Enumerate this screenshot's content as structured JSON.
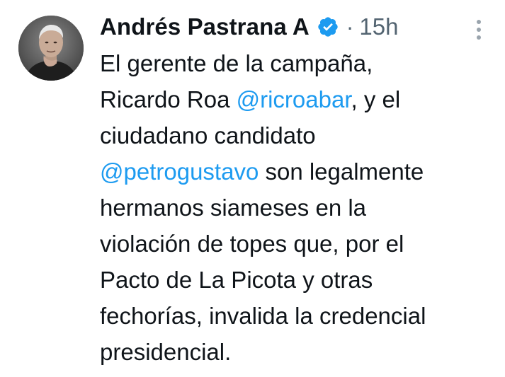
{
  "author": {
    "display_name": "Andrés Pastrana A",
    "verified": true,
    "time_separator": "·",
    "time": "15h"
  },
  "icons": {
    "verified": "verified-badge-icon",
    "more": "more-options-icon"
  },
  "colors": {
    "mention": "#1d9bf0",
    "verified": "#1d9bf0",
    "secondary_text": "#536471",
    "text": "#0f1419"
  },
  "tweet": {
    "lines": [
      {
        "segments": [
          {
            "text": "El gerente de la campaña,"
          }
        ]
      },
      {
        "segments": [
          {
            "text": "Ricardo Roa "
          },
          {
            "text": "@ricroabar",
            "mention": true
          },
          {
            "text": ", y el"
          }
        ]
      },
      {
        "segments": [
          {
            "text": "ciudadano candidato"
          }
        ]
      },
      {
        "segments": [
          {
            "text": "@petrogustavo",
            "mention": true
          },
          {
            "text": " son legalmente"
          }
        ]
      },
      {
        "segments": [
          {
            "text": "hermanos siameses en la"
          }
        ]
      },
      {
        "segments": [
          {
            "text": "violación de topes que, por el"
          }
        ]
      },
      {
        "segments": [
          {
            "text": "Pacto de La Picota y otras"
          }
        ]
      },
      {
        "segments": [
          {
            "text": "fechorías, invalida la credencial"
          }
        ]
      },
      {
        "segments": [
          {
            "text": "presidencial."
          }
        ]
      }
    ]
  }
}
